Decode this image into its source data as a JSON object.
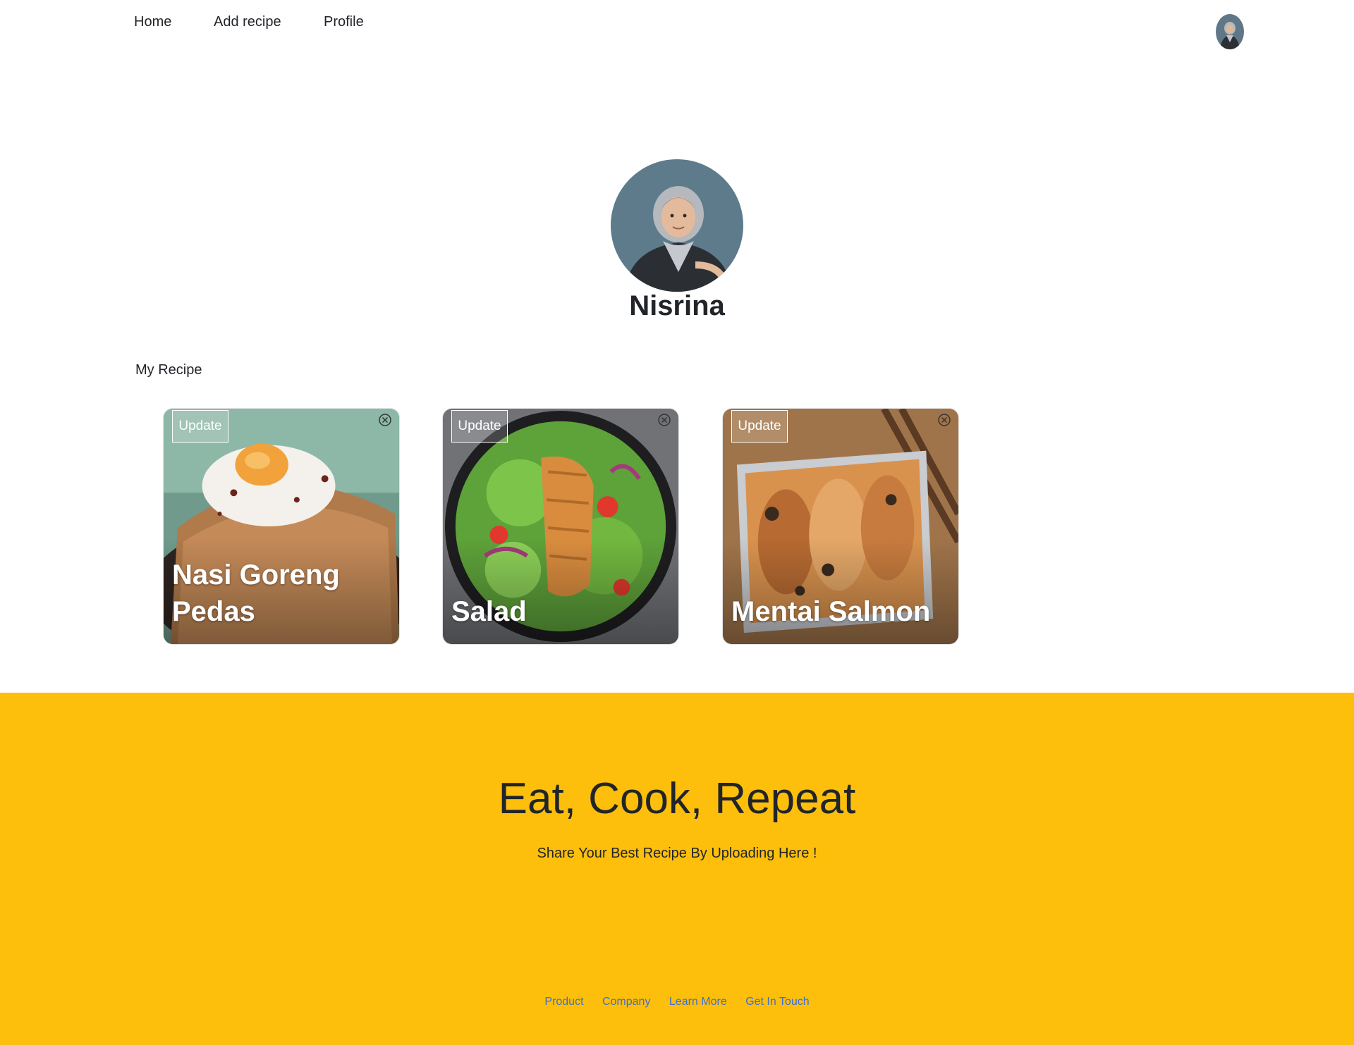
{
  "nav": {
    "items": [
      {
        "label": "Home"
      },
      {
        "label": "Add recipe"
      },
      {
        "label": "Profile"
      }
    ]
  },
  "profile": {
    "name": "Nisrina"
  },
  "section": {
    "title": "My Recipe"
  },
  "recipes": [
    {
      "title": "Nasi Goreng Pedas",
      "update_label": "Update"
    },
    {
      "title": "Salad",
      "update_label": "Update"
    },
    {
      "title": "Mentai Salmon",
      "update_label": "Update"
    }
  ],
  "footer": {
    "title": "Eat, Cook, Repeat",
    "subtitle": "Share Your Best Recipe By Uploading Here !",
    "links": [
      {
        "label": "Product"
      },
      {
        "label": "Company"
      },
      {
        "label": "Learn More"
      },
      {
        "label": "Get In Touch"
      }
    ]
  },
  "colors": {
    "footer_bg": "#fdbf0b",
    "link": "#3b6fd8"
  },
  "icons": {
    "delete": "close-circle-icon"
  }
}
